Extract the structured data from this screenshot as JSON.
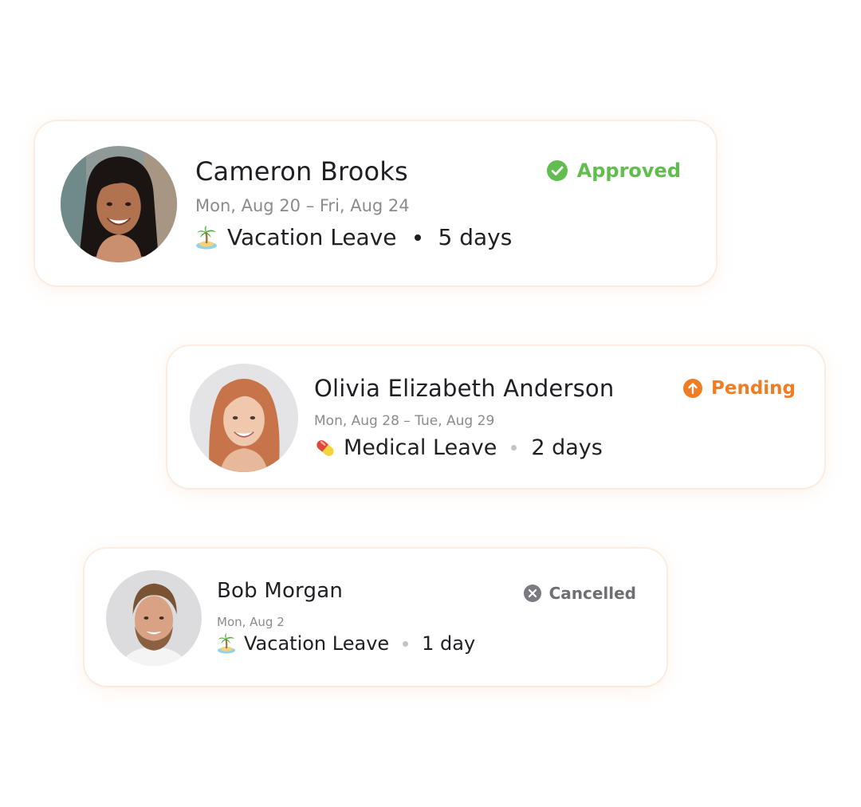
{
  "colors": {
    "approved": "#62bd4f",
    "pending": "#f07d24",
    "cancelled": "#6e6e73",
    "name_text": "#1f1f24",
    "date_text": "#8a8a90",
    "card_glow": "#fae1cd"
  },
  "requests": [
    {
      "name": "Cameron Brooks",
      "dates": "Mon, Aug 20 – Fri, Aug 24",
      "leave_icon": "palm-island-icon",
      "leave_type": "Vacation Leave",
      "duration": "5 days",
      "status": "Approved",
      "status_icon": "check-circle-icon"
    },
    {
      "name": "Olivia Elizabeth Anderson",
      "dates": "Mon, Aug 28 – Tue, Aug 29",
      "leave_icon": "pill-icon",
      "leave_type": "Medical Leave",
      "duration": "2 days",
      "status": "Pending",
      "status_icon": "arrow-up-circle-icon"
    },
    {
      "name": "Bob Morgan",
      "dates": "Mon, Aug 2",
      "leave_icon": "palm-island-icon",
      "leave_type": "Vacation Leave",
      "duration": "1 day",
      "status": "Cancelled",
      "status_icon": "x-circle-icon"
    }
  ]
}
